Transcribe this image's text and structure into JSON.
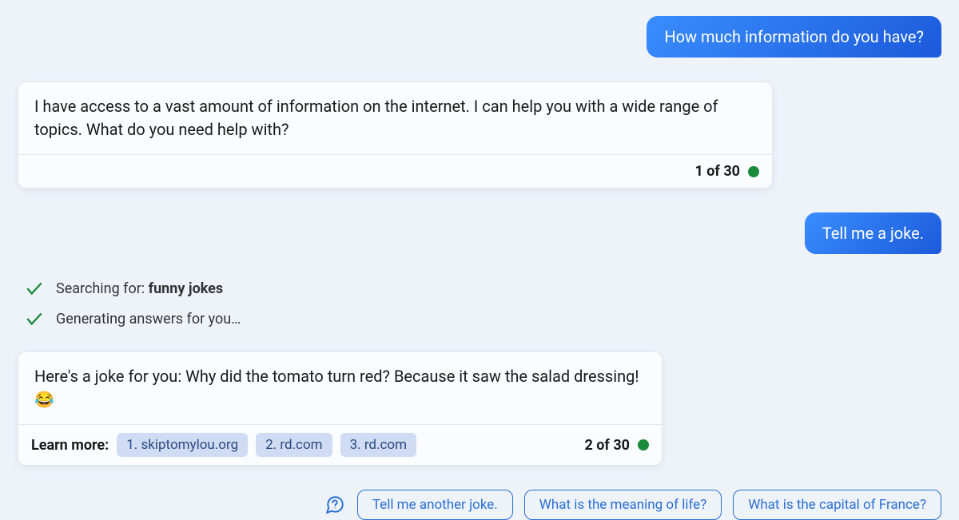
{
  "messages": {
    "user1": "How much information do you have?",
    "bot1": {
      "text": "I have access to a vast amount of information on the internet. I can help you with a wide range of topics. What do you need help with?",
      "counter": "1 of 30"
    },
    "user2": "Tell me a joke.",
    "status": {
      "searching_prefix": "Searching for: ",
      "searching_query": "funny jokes",
      "generating": "Generating answers for you…"
    },
    "bot2": {
      "text": "Here's a joke for you: Why did the tomato turn red? Because it saw the salad dressing! 😂",
      "learn_label": "Learn more:",
      "citations": [
        "1. skiptomylou.org",
        "2. rd.com",
        "3. rd.com"
      ],
      "counter": "2 of 30"
    }
  },
  "suggestions": [
    "Tell me another joke.",
    "What is the meaning of life?",
    "What is the capital of France?"
  ]
}
